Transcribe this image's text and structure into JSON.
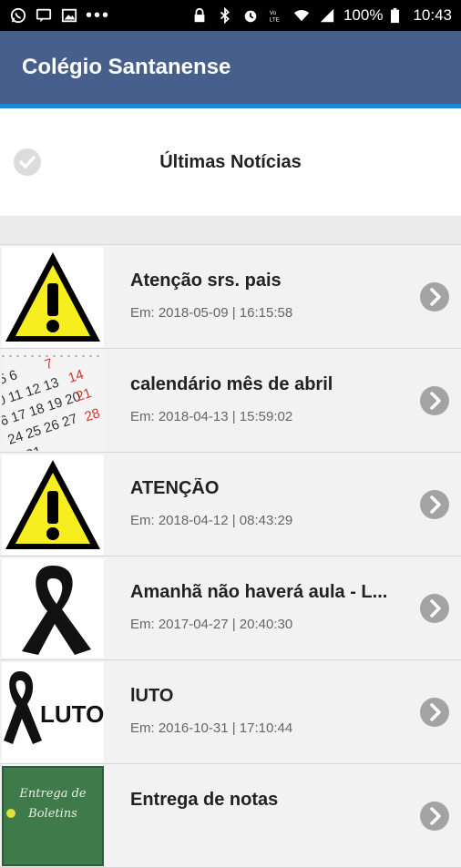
{
  "status_bar": {
    "battery": "100%",
    "time": "10:43",
    "left_icons": [
      "whatsapp-icon",
      "message-icon",
      "image-icon",
      "more-dots-icon"
    ],
    "right_icons": [
      "lock-icon",
      "bluetooth-icon",
      "alarm-icon",
      "volte-icon",
      "wifi-icon",
      "signal-icon",
      "battery-icon"
    ]
  },
  "app_bar": {
    "title": "Colégio Santanense"
  },
  "section": {
    "title": "Últimas Notícias"
  },
  "colors": {
    "app_bar": "#475f8d",
    "accent": "#1e88d6",
    "chevron": "#9e9e9e"
  },
  "news": [
    {
      "title": "Atenção srs. pais",
      "date": "Em: 2018-05-09 | 16:15:58",
      "thumb": "warning-icon"
    },
    {
      "title": "calendário mês de abril",
      "date": "Em: 2018-04-13 | 15:59:02",
      "thumb": "calendar-image"
    },
    {
      "title": "ATENÇÃO",
      "date": "Em: 2018-04-12 | 08:43:29",
      "thumb": "warning-icon"
    },
    {
      "title": "Amanhã não haverá aula - L...",
      "date": "Em: 2017-04-27 | 20:40:30",
      "thumb": "mourning-ribbon-icon"
    },
    {
      "title": "lUTO",
      "date": "Em: 2016-10-31 | 17:10:44",
      "thumb": "luto-image",
      "thumb_text": "LUTO"
    },
    {
      "title": "Entrega de notas",
      "date": "",
      "thumb": "chalkboard-image",
      "thumb_text": "Entrega de Boletins"
    }
  ]
}
